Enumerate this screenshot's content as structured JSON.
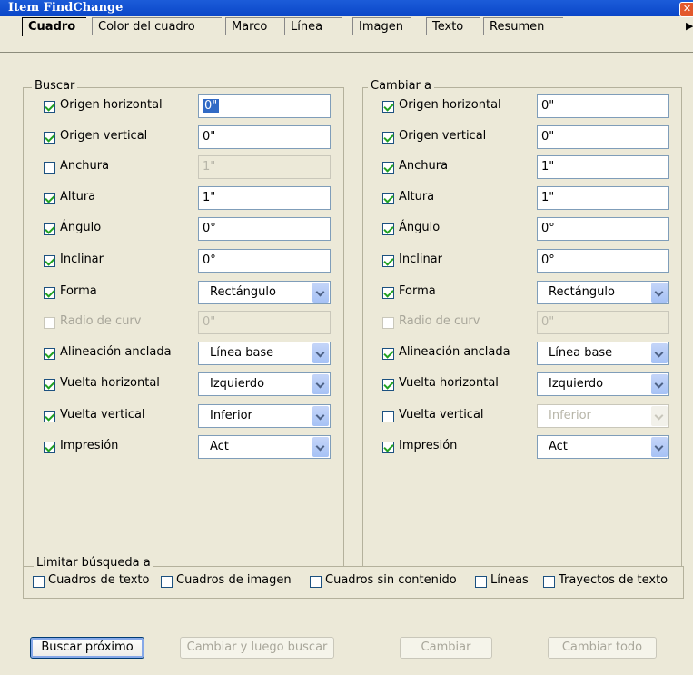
{
  "window": {
    "title": "Item FindChange",
    "close_label": "✕"
  },
  "tabs": [
    {
      "label": "Cuadro",
      "active": true
    },
    {
      "label": "Color del cuadro"
    },
    {
      "label": "Marco"
    },
    {
      "label": "Línea"
    },
    {
      "label": "Imagen"
    },
    {
      "label": "Texto"
    },
    {
      "label": "Resumen"
    }
  ],
  "buscar": {
    "legend": "Buscar",
    "rows": [
      {
        "label": "Origen horizontal",
        "checked": true,
        "value": "0\""
      },
      {
        "label": "Origen vertical",
        "checked": true,
        "value": "0\""
      },
      {
        "label": "Anchura",
        "checked": false,
        "value": "1\"",
        "disabled_field": true
      },
      {
        "label": "Altura",
        "checked": true,
        "value": "1\""
      },
      {
        "label": "Ángulo",
        "checked": true,
        "value": "0°"
      },
      {
        "label": "Inclinar",
        "checked": true,
        "value": "0°"
      },
      {
        "label": "Forma",
        "checked": true,
        "value": "Rectángulo",
        "dropdown": true
      },
      {
        "label": "Radio de curv",
        "checked": false,
        "value": "0\"",
        "disabled": true
      },
      {
        "label": "Alineación anclada",
        "checked": true,
        "value": "Línea base",
        "dropdown": true
      },
      {
        "label": "Vuelta horizontal",
        "checked": true,
        "value": "Izquierdo",
        "dropdown": true
      },
      {
        "label": "Vuelta vertical",
        "checked": true,
        "value": "Inferior",
        "dropdown": true
      },
      {
        "label": "Impresión",
        "checked": true,
        "value": "Act",
        "dropdown": true
      }
    ]
  },
  "cambiar": {
    "legend": "Cambiar a",
    "rows": [
      {
        "label": "Origen horizontal",
        "checked": true,
        "value": "0\""
      },
      {
        "label": "Origen vertical",
        "checked": true,
        "value": "0\""
      },
      {
        "label": "Anchura",
        "checked": true,
        "value": "1\""
      },
      {
        "label": "Altura",
        "checked": true,
        "value": "1\""
      },
      {
        "label": "Ángulo",
        "checked": true,
        "value": "0°"
      },
      {
        "label": "Inclinar",
        "checked": true,
        "value": "0°"
      },
      {
        "label": "Forma",
        "checked": true,
        "value": "Rectángulo",
        "dropdown": true
      },
      {
        "label": "Radio de curv",
        "checked": false,
        "value": "0\"",
        "disabled": true
      },
      {
        "label": "Alineación anclada",
        "checked": true,
        "value": "Línea base",
        "dropdown": true
      },
      {
        "label": "Vuelta horizontal",
        "checked": true,
        "value": "Izquierdo",
        "dropdown": true
      },
      {
        "label": "Vuelta vertical",
        "checked": false,
        "value": "Inferior",
        "dropdown": true,
        "disabled_field": true
      },
      {
        "label": "Impresión",
        "checked": true,
        "value": "Act",
        "dropdown": true
      }
    ]
  },
  "limitar": {
    "legend": "Limitar búsqueda a",
    "options": [
      {
        "label": "Cuadros de texto",
        "checked": false
      },
      {
        "label": "Cuadros de imagen",
        "checked": false
      },
      {
        "label": "Cuadros sin contenido",
        "checked": false
      },
      {
        "label": "Líneas",
        "checked": false
      },
      {
        "label": "Trayectos de texto",
        "checked": false
      }
    ]
  },
  "buttons": {
    "find_next": "Buscar próximo",
    "change_then_find": "Cambiar y luego buscar",
    "change": "Cambiar",
    "change_all": "Cambiar todo"
  }
}
